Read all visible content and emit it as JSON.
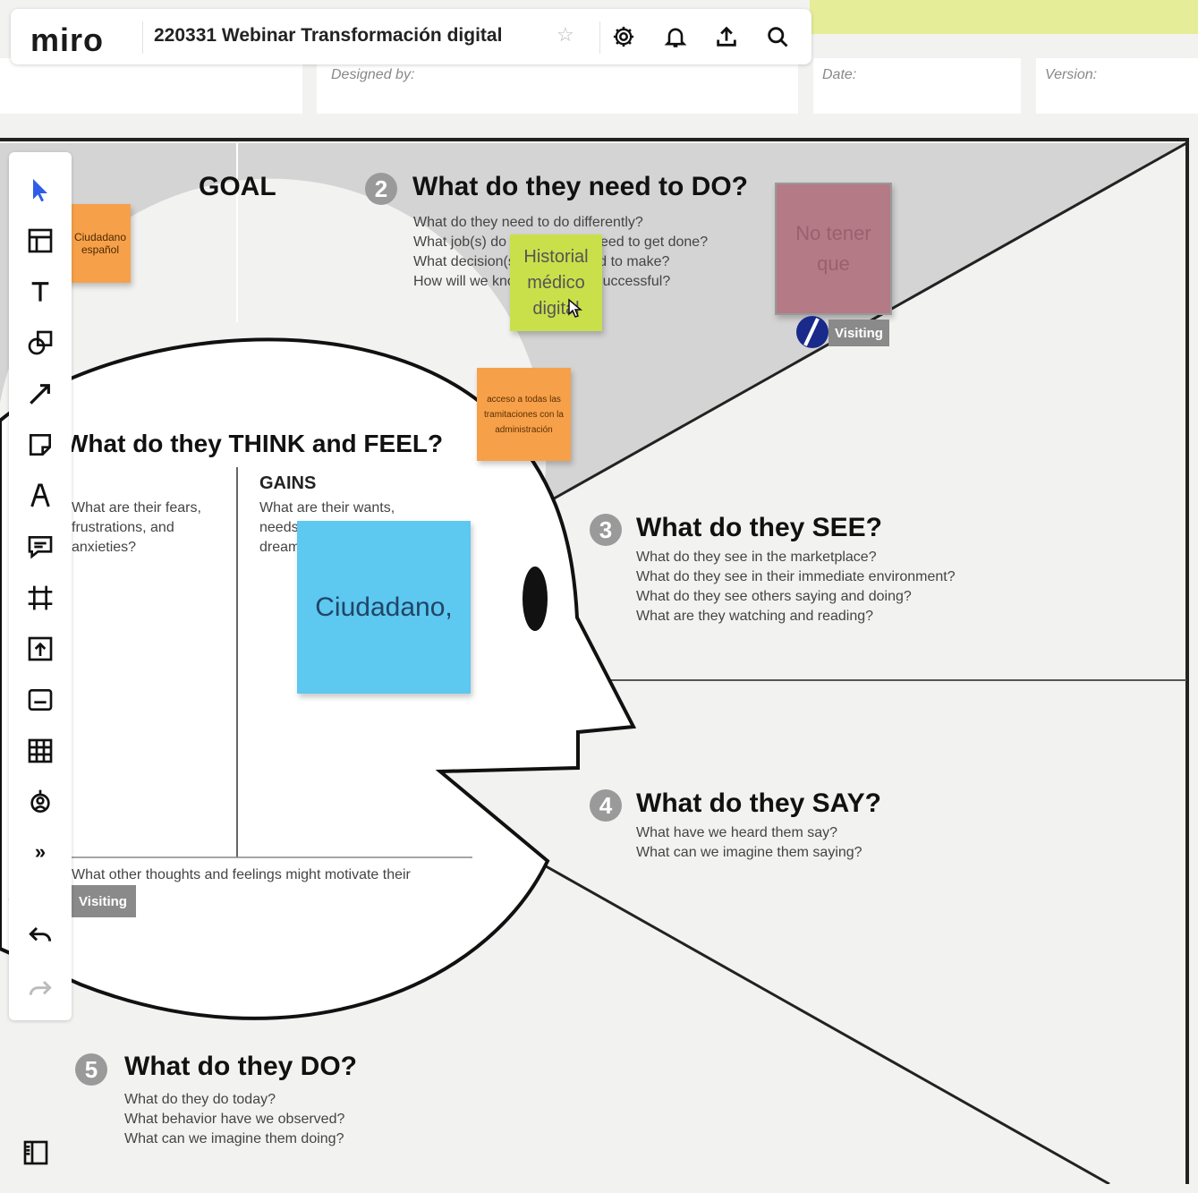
{
  "app": {
    "logo": "miro",
    "board_title": "220331 Webinar Transformación digital",
    "icons": [
      "star-icon",
      "settings-icon",
      "bell-icon",
      "upload-icon",
      "search-icon"
    ]
  },
  "header_fields": {
    "designed_by_label": "Designed by:",
    "date_label": "Date:",
    "version_label": "Version:"
  },
  "toolbar": {
    "tools": [
      "select-icon",
      "template-icon",
      "text-icon",
      "shapes-icon",
      "connector-icon",
      "sticky-note-icon",
      "pen-icon",
      "comment-icon",
      "frame-icon",
      "upload-icon",
      "card-icon",
      "table-icon",
      "mind-map-icon",
      "more-icon",
      "undo-icon",
      "redo-icon"
    ],
    "more_label": "»",
    "panel_icon": "sidebar-panel-icon"
  },
  "canvas": {
    "goal": {
      "title": "GOAL"
    },
    "do_need": {
      "number": "2",
      "title": "What do they need to DO?",
      "lines": [
        "What do they need to do differently?",
        "What job(s) do they want or need to get done?",
        "What decision(s) do they need to make?",
        "How will we know they were successful?"
      ]
    },
    "think_feel": {
      "title": "What do they THINK and FEEL?",
      "gains_title": "GAINS",
      "gains_text": "What are their wants, needs, hopes and dreams?",
      "pains_text": "What are their fears, frustrations, and anxieties?",
      "motivate_text": "What other thoughts and feelings might motivate their behavior?"
    },
    "see": {
      "number": "3",
      "title": "What do they SEE?",
      "lines": [
        "What do they see in the marketplace?",
        "What do they see in their immediate environment?",
        "What do they see others saying and doing?",
        "What are they watching and reading?"
      ]
    },
    "say": {
      "number": "4",
      "title": "What do they SAY?",
      "lines": [
        "What have we heard them say?",
        "What can we imagine them saying?"
      ]
    },
    "do_today": {
      "number": "5",
      "title": "What do they DO?",
      "lines": [
        "What do they do today?",
        "What behavior have we observed?",
        "What can we imagine them doing?"
      ]
    },
    "stickies": {
      "orange_top": "Ciudadano español",
      "green": "Historial médico digital",
      "maroon": "No tener que",
      "orange_small": "acceso a todas las tramitaciones con la administración",
      "blue": "Ciudadano,"
    },
    "cursors": {
      "visiting_1": "Visiting",
      "visiting_2": "Visiting"
    },
    "colors": {
      "orange": "#f7a04a",
      "green": "#c9e04a",
      "maroon": "#b47b86",
      "blue": "#5dc8f0",
      "gray_region": "#d4d4d4"
    }
  }
}
